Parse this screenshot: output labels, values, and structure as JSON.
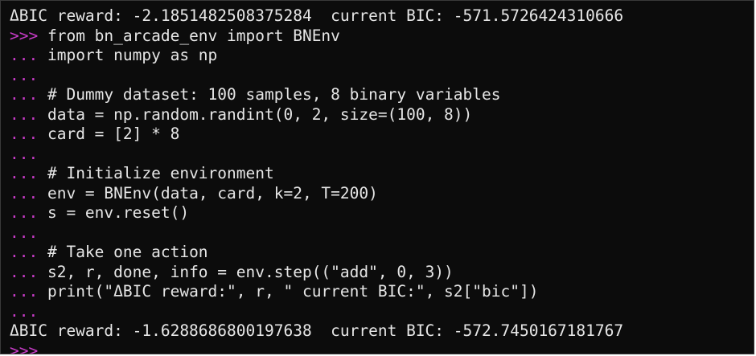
{
  "terminal": {
    "colors": {
      "background": "#0c0c0c",
      "text": "#e6e6e6",
      "prompt": "#c83cc8"
    },
    "lines": [
      {
        "prompt": "",
        "text": "ΔBIC reward: -2.1851482508375284  current BIC: -571.5726424310666"
      },
      {
        "prompt": ">>> ",
        "text": "from bn_arcade_env import BNEnv"
      },
      {
        "prompt": "... ",
        "text": "import numpy as np"
      },
      {
        "prompt": "...",
        "text": ""
      },
      {
        "prompt": "... ",
        "text": "# Dummy dataset: 100 samples, 8 binary variables"
      },
      {
        "prompt": "... ",
        "text": "data = np.random.randint(0, 2, size=(100, 8))"
      },
      {
        "prompt": "... ",
        "text": "card = [2] * 8"
      },
      {
        "prompt": "...",
        "text": ""
      },
      {
        "prompt": "... ",
        "text": "# Initialize environment"
      },
      {
        "prompt": "... ",
        "text": "env = BNEnv(data, card, k=2, T=200)"
      },
      {
        "prompt": "... ",
        "text": "s = env.reset()"
      },
      {
        "prompt": "...",
        "text": ""
      },
      {
        "prompt": "... ",
        "text": "# Take one action"
      },
      {
        "prompt": "... ",
        "text": "s2, r, done, info = env.step((\"add\", 0, 3))"
      },
      {
        "prompt": "... ",
        "text": "print(\"ΔBIC reward:\", r, \" current BIC:\", s2[\"bic\"])"
      },
      {
        "prompt": "...",
        "text": ""
      },
      {
        "prompt": "",
        "text": "ΔBIC reward: -1.6288686800197638  current BIC: -572.7450167181767"
      },
      {
        "prompt": ">>>",
        "text": ""
      }
    ]
  }
}
